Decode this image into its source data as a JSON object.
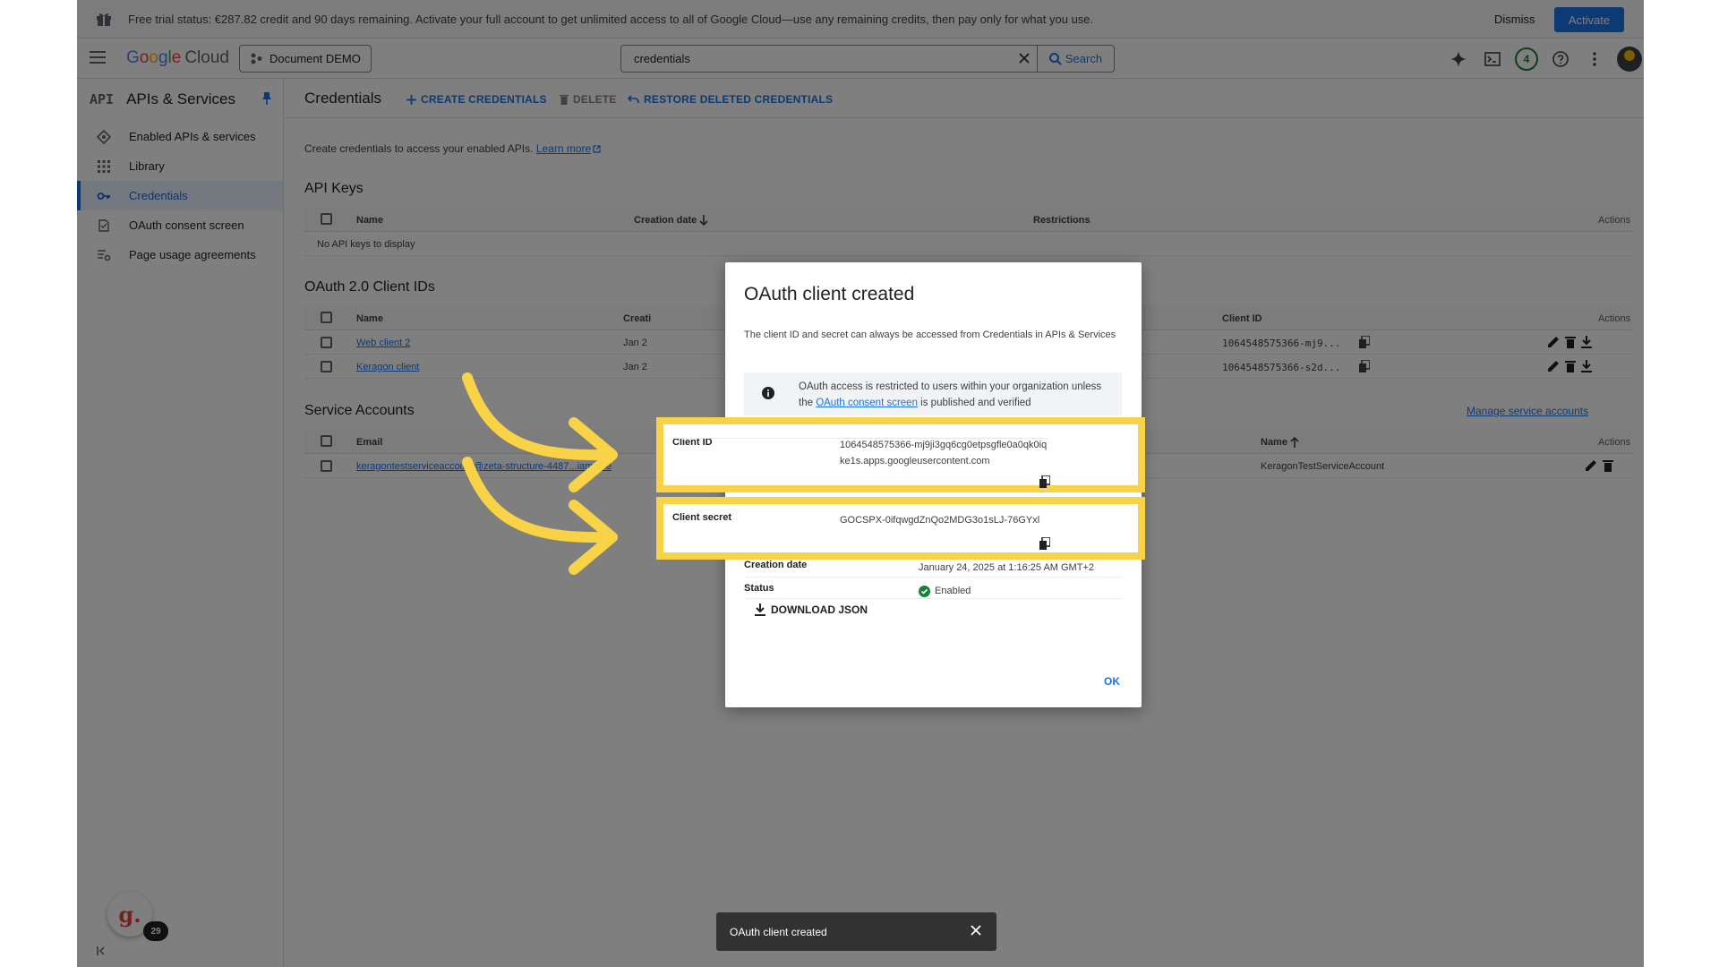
{
  "trial": {
    "message": "Free trial status: €287.82 credit and 90 days remaining. Activate your full account to get unlimited access to all of Google Cloud—use any remaining credits, then pay only for what you use.",
    "dismiss": "Dismiss",
    "activate": "Activate"
  },
  "header": {
    "logo_google": [
      "G",
      "o",
      "o",
      "g",
      "l",
      "e"
    ],
    "logo_cloud": "Cloud",
    "project": "Document DEMO",
    "search_value": "credentials",
    "search_button": "Search",
    "notifications_count": "4"
  },
  "nav": {
    "api_glyph": "API",
    "title": "APIs & Services",
    "items": [
      {
        "label": "Enabled APIs & services",
        "icon": "diamond-icon"
      },
      {
        "label": "Library",
        "icon": "grid-icon"
      },
      {
        "label": "Credentials",
        "icon": "key-icon",
        "active": true
      },
      {
        "label": "OAuth consent screen",
        "icon": "consent-icon"
      },
      {
        "label": "Page usage agreements",
        "icon": "settings-list-icon"
      }
    ]
  },
  "main": {
    "title": "Credentials",
    "actions": {
      "create": "CREATE CREDENTIALS",
      "delete": "DELETE",
      "restore": "RESTORE DELETED CREDENTIALS"
    },
    "intro": "Create credentials to access your enabled APIs.",
    "learn_more": "Learn more",
    "api_keys": {
      "title": "API Keys",
      "headers": {
        "name": "Name",
        "creation_date": "Creation date",
        "restrictions": "Restrictions",
        "actions": "Actions"
      },
      "empty": "No API keys to display"
    },
    "oauth": {
      "title": "OAuth 2.0 Client IDs",
      "headers": {
        "name": "Name",
        "creation": "Creati",
        "client_id": "Client ID",
        "actions": "Actions"
      },
      "rows": [
        {
          "name": "Web client 2",
          "date": "Jan 2",
          "client_id": "1064548575366-mj9..."
        },
        {
          "name": "Keragon client",
          "date": "Jan 2",
          "client_id": "1064548575366-s2d..."
        }
      ]
    },
    "service_accounts": {
      "title": "Service Accounts",
      "manage": "Manage service accounts",
      "headers": {
        "email": "Email",
        "name": "Name",
        "actions": "Actions"
      },
      "rows": [
        {
          "email": "keragontestserviceaccount@zeta-structure-4487...iam.gse",
          "name": "KeragonTestServiceAccount"
        }
      ]
    }
  },
  "dialog": {
    "title": "OAuth client created",
    "description": "The client ID and secret can always be accessed from Credentials in APIs & Services",
    "info_pre": "OAuth access is restricted to users within your organization unless the ",
    "info_link": "OAuth consent screen",
    "info_post": " is published and verified",
    "client_id_label": "Client ID",
    "client_id_value": "1064548575366-mj9ji3gq6cg0etpsgfle0a0qk0iqke1s.apps.googleusercontent.com",
    "client_secret_label": "Client secret",
    "client_secret_value": "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",
    "creation_date_label": "Creation date",
    "creation_date_value": "January 24, 2025 at 1:16:25 AM GMT+2",
    "status_label": "Status",
    "status_value": "Enabled",
    "download": "DOWNLOAD JSON",
    "ok": "OK"
  },
  "toast": {
    "message": "OAuth client created"
  },
  "guide": {
    "letter": "g.",
    "count": "29"
  },
  "colors": {
    "accent": "#1a73e8",
    "highlight": "#f8d347",
    "success": "#188038"
  }
}
